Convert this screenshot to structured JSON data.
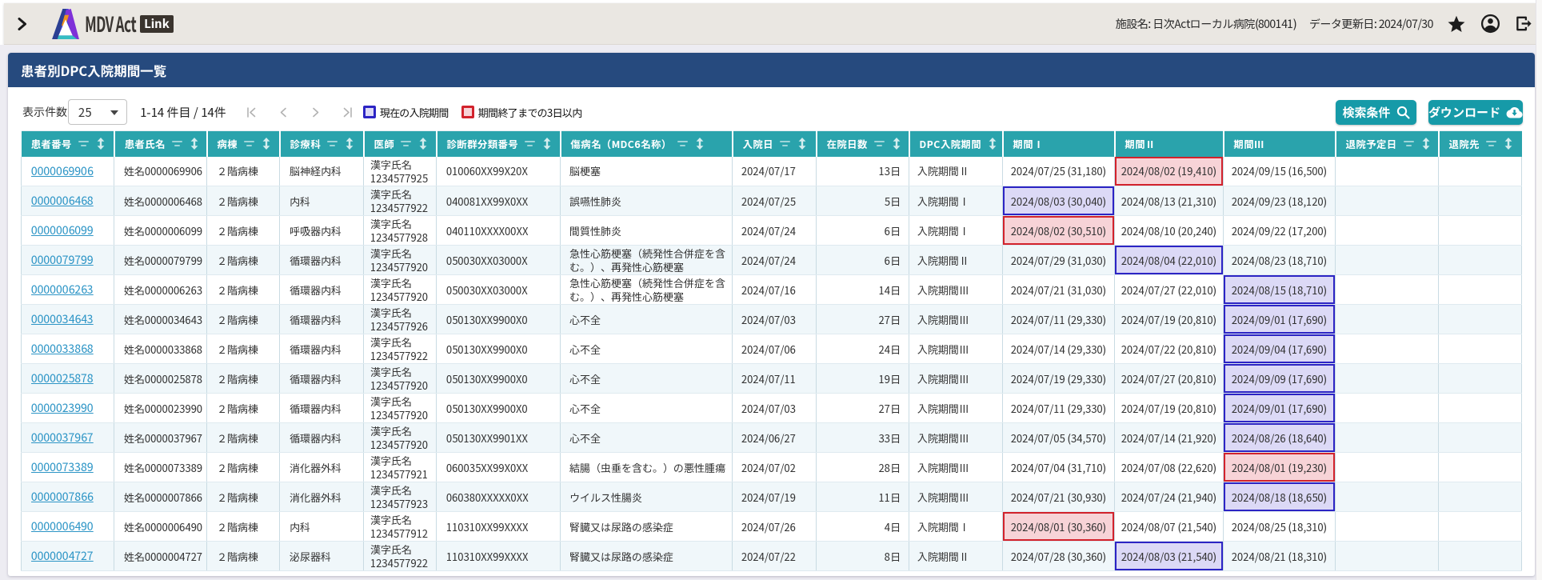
{
  "header": {
    "expand_icon": "chevron-right",
    "logo_text": "MDV Act",
    "logo_badge": "Link",
    "facility_text": "施設名: 日次Actローカル病院(800141)",
    "updated_text": "データ更新日: 2024/07/30",
    "icons": [
      "favorite-star",
      "account",
      "logout"
    ]
  },
  "page": {
    "title": "患者別DPC入院期間一覧"
  },
  "toolbar": {
    "page_size_label": "表示件数",
    "page_size_value": "25",
    "range_text": "1-14 件目 / 14件",
    "pagination": [
      "first",
      "prev",
      "next",
      "last"
    ],
    "legend": [
      {
        "label": "現在の入院期間",
        "type": "current",
        "border_color": "#2c24c4",
        "fill_color": "#dcd9f6"
      },
      {
        "label": "期間終了までの3日以内",
        "type": "ending",
        "border_color": "#d2222c",
        "fill_color": "#f7d3d7"
      }
    ],
    "search_button_label": "検索条件",
    "download_button_label": "ダウンロード"
  },
  "table": {
    "columns": [
      {
        "key": "patient_no",
        "label": "患者番号",
        "filter": true,
        "sort": true
      },
      {
        "key": "name",
        "label": "患者氏名",
        "filter": true,
        "sort": true
      },
      {
        "key": "ward",
        "label": "病棟",
        "filter": true,
        "sort": true
      },
      {
        "key": "department",
        "label": "診療科",
        "filter": true,
        "sort": true
      },
      {
        "key": "doctor",
        "label": "医師",
        "filter": true,
        "sort": true
      },
      {
        "key": "dpc_code",
        "label": "診断群分類番号",
        "filter": true,
        "sort": true
      },
      {
        "key": "disease",
        "label": "傷病名（MDC6名称）",
        "filter": true,
        "sort": true
      },
      {
        "key": "admission_date",
        "label": "入院日",
        "filter": true,
        "sort": true
      },
      {
        "key": "days",
        "label": "在院日数",
        "filter": true,
        "sort": true
      },
      {
        "key": "dpc_period",
        "label": "DPC入院期間",
        "filter": false,
        "sort": true
      },
      {
        "key": "period1",
        "label": "期間Ⅰ",
        "filter": false,
        "sort": false
      },
      {
        "key": "period2",
        "label": "期間Ⅱ",
        "filter": false,
        "sort": false
      },
      {
        "key": "period3",
        "label": "期間Ⅲ",
        "filter": false,
        "sort": false
      },
      {
        "key": "discharge_date",
        "label": "退院予定日",
        "filter": true,
        "sort": true
      },
      {
        "key": "discharge_to",
        "label": "退院先",
        "filter": true,
        "sort": true
      }
    ],
    "rows": [
      {
        "patient_no": "0000069906",
        "name": "姓名0000069906",
        "ward": "２階病棟",
        "department": "脳神経内科",
        "doctor": "漢字氏名1234577925",
        "dpc_code": "010060XX99X20X",
        "disease": "脳梗塞",
        "admission_date": "2024/07/17",
        "days": "13日",
        "dpc_period": "入院期間Ⅱ",
        "period1": "2024/07/25 (31,180)",
        "period2": "2024/08/02 (19,410)",
        "period3": "2024/09/15 (16,500)",
        "discharge_date": "",
        "discharge_to": "",
        "highlights": {
          "period2": "ending"
        }
      },
      {
        "patient_no": "0000006468",
        "name": "姓名0000006468",
        "ward": "２階病棟",
        "department": "内科",
        "doctor": "漢字氏名1234577922",
        "dpc_code": "040081XX99X0XX",
        "disease": "誤嚥性肺炎",
        "admission_date": "2024/07/25",
        "days": "5日",
        "dpc_period": "入院期間Ⅰ",
        "period1": "2024/08/03 (30,040)",
        "period2": "2024/08/13 (21,310)",
        "period3": "2024/09/23 (18,120)",
        "discharge_date": "",
        "discharge_to": "",
        "highlights": {
          "period1": "current"
        }
      },
      {
        "patient_no": "0000006099",
        "name": "姓名0000006099",
        "ward": "２階病棟",
        "department": "呼吸器内科",
        "doctor": "漢字氏名1234577928",
        "dpc_code": "040110XXXX00XX",
        "disease": "間質性肺炎",
        "admission_date": "2024/07/24",
        "days": "6日",
        "dpc_period": "入院期間Ⅰ",
        "period1": "2024/08/02 (30,510)",
        "period2": "2024/08/10 (20,240)",
        "period3": "2024/09/22 (17,200)",
        "discharge_date": "",
        "discharge_to": "",
        "highlights": {
          "period1": "ending"
        }
      },
      {
        "patient_no": "0000079799",
        "name": "姓名0000079799",
        "ward": "２階病棟",
        "department": "循環器内科",
        "doctor": "漢字氏名1234577920",
        "dpc_code": "050030XX03000X",
        "disease": "急性心筋梗塞（続発性合併症を含む。）、再発性心筋梗塞",
        "admission_date": "2024/07/24",
        "days": "6日",
        "dpc_period": "入院期間Ⅱ",
        "period1": "2024/07/29 (31,030)",
        "period2": "2024/08/04 (22,010)",
        "period3": "2024/08/23 (18,710)",
        "discharge_date": "",
        "discharge_to": "",
        "highlights": {
          "period2": "current"
        }
      },
      {
        "patient_no": "0000006263",
        "name": "姓名0000006263",
        "ward": "２階病棟",
        "department": "循環器内科",
        "doctor": "漢字氏名1234577920",
        "dpc_code": "050030XX03000X",
        "disease": "急性心筋梗塞（続発性合併症を含む。）、再発性心筋梗塞",
        "admission_date": "2024/07/16",
        "days": "14日",
        "dpc_period": "入院期間Ⅲ",
        "period1": "2024/07/21 (31,030)",
        "period2": "2024/07/27 (22,010)",
        "period3": "2024/08/15 (18,710)",
        "discharge_date": "",
        "discharge_to": "",
        "highlights": {
          "period3": "current"
        }
      },
      {
        "patient_no": "0000034643",
        "name": "姓名0000034643",
        "ward": "２階病棟",
        "department": "循環器内科",
        "doctor": "漢字氏名1234577926",
        "dpc_code": "050130XX9900X0",
        "disease": "心不全",
        "admission_date": "2024/07/03",
        "days": "27日",
        "dpc_period": "入院期間Ⅲ",
        "period1": "2024/07/11 (29,330)",
        "period2": "2024/07/19 (20,810)",
        "period3": "2024/09/01 (17,690)",
        "discharge_date": "",
        "discharge_to": "",
        "highlights": {
          "period3": "current"
        }
      },
      {
        "patient_no": "0000033868",
        "name": "姓名0000033868",
        "ward": "２階病棟",
        "department": "循環器内科",
        "doctor": "漢字氏名1234577922",
        "dpc_code": "050130XX9900X0",
        "disease": "心不全",
        "admission_date": "2024/07/06",
        "days": "24日",
        "dpc_period": "入院期間Ⅲ",
        "period1": "2024/07/14 (29,330)",
        "period2": "2024/07/22 (20,810)",
        "period3": "2024/09/04 (17,690)",
        "discharge_date": "",
        "discharge_to": "",
        "highlights": {
          "period3": "current"
        }
      },
      {
        "patient_no": "0000025878",
        "name": "姓名0000025878",
        "ward": "２階病棟",
        "department": "循環器内科",
        "doctor": "漢字氏名1234577920",
        "dpc_code": "050130XX9900X0",
        "disease": "心不全",
        "admission_date": "2024/07/11",
        "days": "19日",
        "dpc_period": "入院期間Ⅲ",
        "period1": "2024/07/19 (29,330)",
        "period2": "2024/07/27 (20,810)",
        "period3": "2024/09/09 (17,690)",
        "discharge_date": "",
        "discharge_to": "",
        "highlights": {
          "period3": "current"
        }
      },
      {
        "patient_no": "0000023990",
        "name": "姓名0000023990",
        "ward": "２階病棟",
        "department": "循環器内科",
        "doctor": "漢字氏名1234577920",
        "dpc_code": "050130XX9900X0",
        "disease": "心不全",
        "admission_date": "2024/07/03",
        "days": "27日",
        "dpc_period": "入院期間Ⅲ",
        "period1": "2024/07/11 (29,330)",
        "period2": "2024/07/19 (20,810)",
        "period3": "2024/09/01 (17,690)",
        "discharge_date": "",
        "discharge_to": "",
        "highlights": {
          "period3": "current"
        }
      },
      {
        "patient_no": "0000037967",
        "name": "姓名0000037967",
        "ward": "２階病棟",
        "department": "循環器内科",
        "doctor": "漢字氏名1234577920",
        "dpc_code": "050130XX9901XX",
        "disease": "心不全",
        "admission_date": "2024/06/27",
        "days": "33日",
        "dpc_period": "入院期間Ⅲ",
        "period1": "2024/07/05 (34,570)",
        "period2": "2024/07/14 (21,920)",
        "period3": "2024/08/26 (18,640)",
        "discharge_date": "",
        "discharge_to": "",
        "highlights": {
          "period3": "current"
        }
      },
      {
        "patient_no": "0000073389",
        "name": "姓名0000073389",
        "ward": "２階病棟",
        "department": "消化器外科",
        "doctor": "漢字氏名1234577921",
        "dpc_code": "060035XX99X0XX",
        "disease": "結腸（虫垂を含む。）の悪性腫瘍",
        "admission_date": "2024/07/02",
        "days": "28日",
        "dpc_period": "入院期間Ⅲ",
        "period1": "2024/07/04 (31,710)",
        "period2": "2024/07/08 (22,620)",
        "period3": "2024/08/01 (19,230)",
        "discharge_date": "",
        "discharge_to": "",
        "highlights": {
          "period3": "ending"
        }
      },
      {
        "patient_no": "0000007866",
        "name": "姓名0000007866",
        "ward": "２階病棟",
        "department": "消化器外科",
        "doctor": "漢字氏名1234577923",
        "dpc_code": "060380XXXXX0XX",
        "disease": "ウイルス性腸炎",
        "admission_date": "2024/07/19",
        "days": "11日",
        "dpc_period": "入院期間Ⅲ",
        "period1": "2024/07/21 (30,930)",
        "period2": "2024/07/24 (21,940)",
        "period3": "2024/08/18 (18,650)",
        "discharge_date": "",
        "discharge_to": "",
        "highlights": {
          "period3": "current"
        }
      },
      {
        "patient_no": "0000006490",
        "name": "姓名0000006490",
        "ward": "２階病棟",
        "department": "内科",
        "doctor": "漢字氏名1234577912",
        "dpc_code": "110310XX99XXXX",
        "disease": "腎臓又は尿路の感染症",
        "admission_date": "2024/07/26",
        "days": "4日",
        "dpc_period": "入院期間Ⅰ",
        "period1": "2024/08/01 (30,360)",
        "period2": "2024/08/07 (21,540)",
        "period3": "2024/08/25 (18,310)",
        "discharge_date": "",
        "discharge_to": "",
        "highlights": {
          "period1": "ending"
        }
      },
      {
        "patient_no": "0000004727",
        "name": "姓名0000004727",
        "ward": "２階病棟",
        "department": "泌尿器科",
        "doctor": "漢字氏名1234577922",
        "dpc_code": "110310XX99XXXX",
        "disease": "腎臓又は尿路の感染症",
        "admission_date": "2024/07/22",
        "days": "8日",
        "dpc_period": "入院期間Ⅱ",
        "period1": "2024/07/28 (30,360)",
        "period2": "2024/08/03 (21,540)",
        "period3": "2024/08/21 (18,310)",
        "discharge_date": "",
        "discharge_to": "",
        "highlights": {
          "period2": "current"
        }
      }
    ]
  },
  "colors": {
    "title_bar": "#264a7e",
    "table_header": "#2aa3ac",
    "button": "#169aa8",
    "link": "#2d95c6",
    "highlight_current_border": "#2c24c4",
    "highlight_current_bg": "#dcd9f6",
    "highlight_ending_border": "#d2222c",
    "highlight_ending_bg": "#f7d3d7"
  }
}
